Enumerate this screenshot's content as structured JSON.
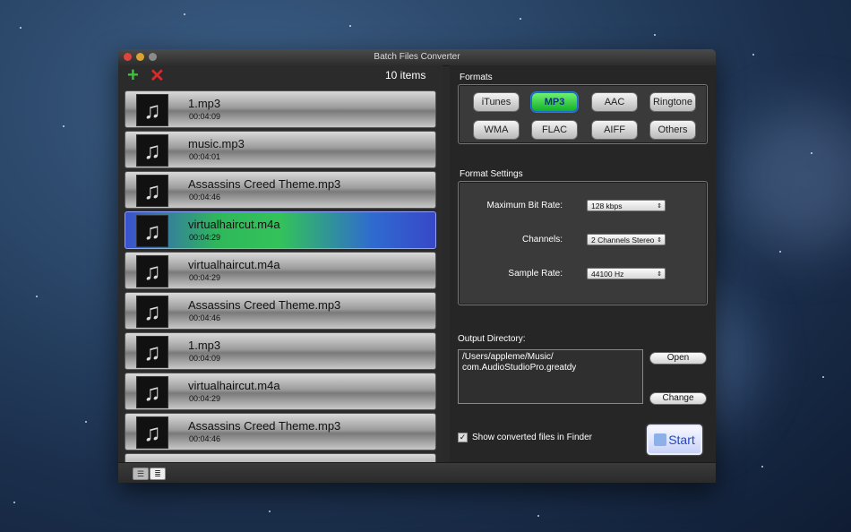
{
  "window": {
    "title": "Batch Files Converter"
  },
  "toolbar": {
    "add_icon": "plus-icon",
    "remove_icon": "cross-icon",
    "count_label": "10 items"
  },
  "files": [
    {
      "name": "1.mp3",
      "duration": "00:04:09",
      "selected": false
    },
    {
      "name": "music.mp3",
      "duration": "00:04:01",
      "selected": false
    },
    {
      "name": "Assassins Creed Theme.mp3",
      "duration": "00:04:46",
      "selected": false
    },
    {
      "name": "virtualhaircut.m4a",
      "duration": "00:04:29",
      "selected": true
    },
    {
      "name": "virtualhaircut.m4a",
      "duration": "00:04:29",
      "selected": false
    },
    {
      "name": "Assassins Creed Theme.mp3",
      "duration": "00:04:46",
      "selected": false
    },
    {
      "name": "1.mp3",
      "duration": "00:04:09",
      "selected": false
    },
    {
      "name": "virtualhaircut.m4a",
      "duration": "00:04:29",
      "selected": false
    },
    {
      "name": "Assassins Creed Theme.mp3",
      "duration": "00:04:46",
      "selected": false
    }
  ],
  "formats": {
    "label": "Formats",
    "options": [
      "iTunes",
      "MP3",
      "AAC",
      "Ringtone",
      "WMA",
      "FLAC",
      "AIFF",
      "Others"
    ],
    "selected": "MP3"
  },
  "settings": {
    "label": "Format Settings",
    "bitrate_label": "Maximum Bit Rate:",
    "bitrate_value": "128 kbps",
    "channels_label": "Channels:",
    "channels_value": "2 Channels Stereo",
    "samplerate_label": "Sample Rate:",
    "samplerate_value": "44100 Hz"
  },
  "output": {
    "label": "Output Directory:",
    "path_line1": "/Users/appleme/Music/",
    "path_line2": "com.AudioStudioPro.greatdy",
    "open_label": "Open",
    "change_label": "Change"
  },
  "finder": {
    "label": "Show converted files in Finder",
    "checked": true,
    "mark": "✓"
  },
  "start": {
    "label": "Start"
  },
  "colors": {
    "accent_green": "#33c25a",
    "selected_blue": "#3a52d0",
    "start_text": "#1d49c9"
  }
}
